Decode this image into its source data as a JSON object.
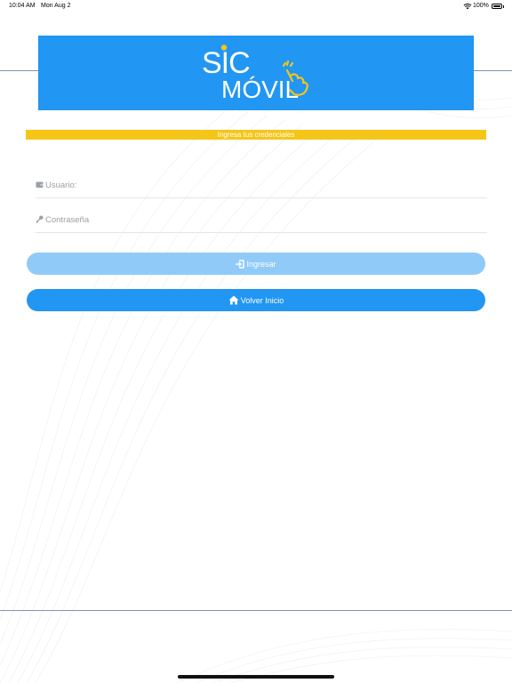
{
  "status_bar": {
    "time": "10:04 AM",
    "date": "Mon Aug 2",
    "battery": "100%",
    "wifi_icon": "wifi-icon",
    "battery_icon": "battery-icon"
  },
  "logo": {
    "line1": "SIC",
    "line2": "MÓVIL",
    "icon": "pointing-hand-icon",
    "banner_color": "#2196f3"
  },
  "credentials_banner": {
    "text": "Ingresa tus credenciales",
    "color": "#f5c518"
  },
  "form": {
    "username": {
      "placeholder": "Usuario:",
      "value": "",
      "icon": "wallet-icon"
    },
    "password": {
      "placeholder": "Contraseña",
      "value": "",
      "icon": "key-icon"
    }
  },
  "buttons": {
    "login": {
      "label": "Ingresar",
      "icon": "sign-in-icon",
      "color": "#90caf9"
    },
    "home": {
      "label": "Volver Inicio",
      "icon": "home-icon",
      "color": "#2196f3"
    }
  }
}
